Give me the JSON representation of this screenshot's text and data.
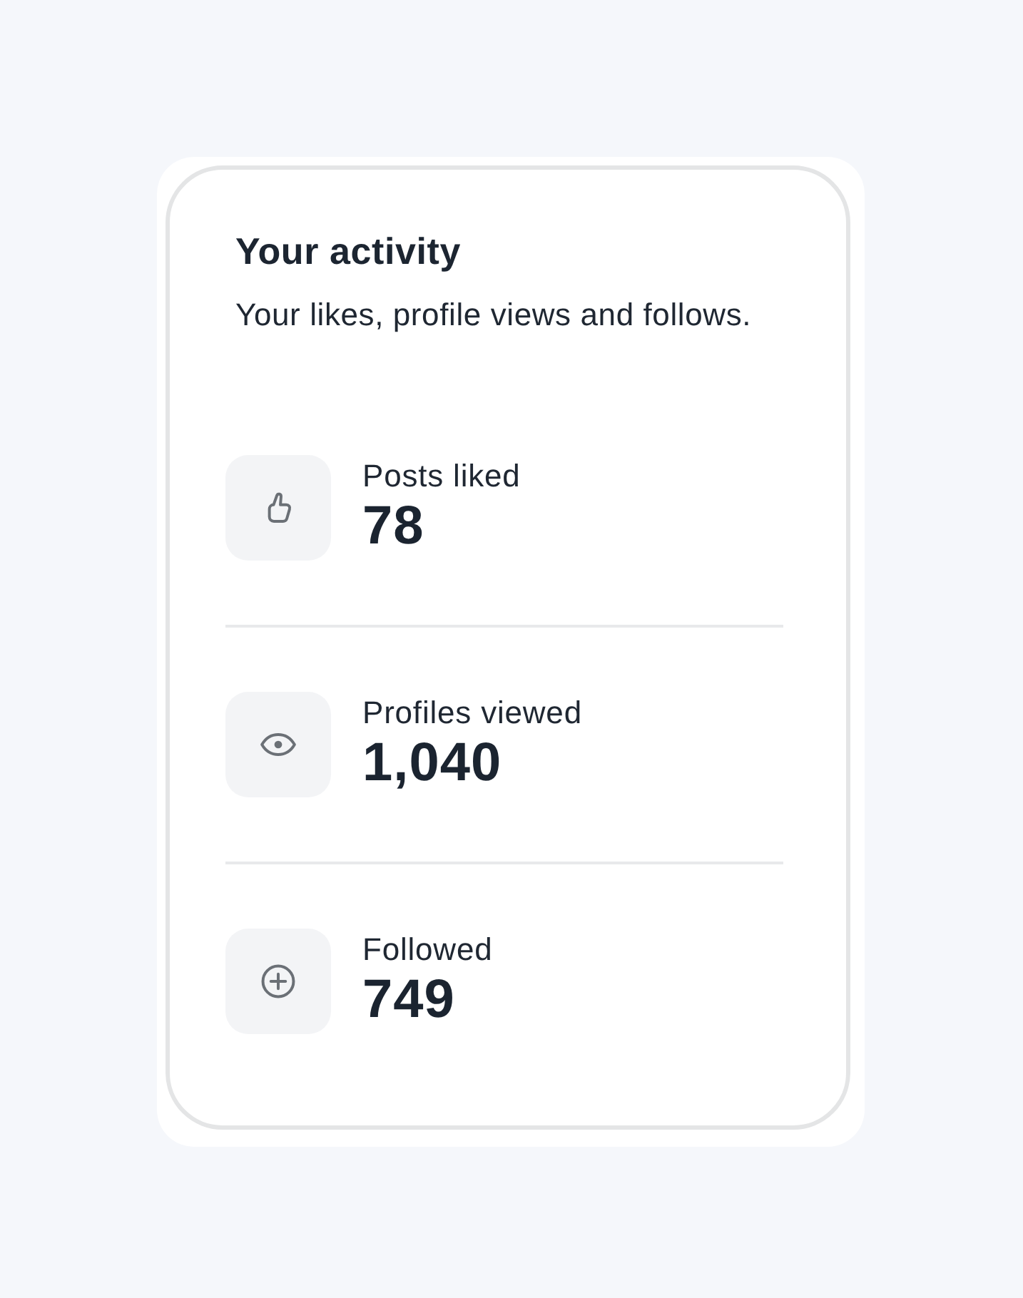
{
  "card": {
    "title": "Your activity",
    "subtitle": "Your likes, profile views and follows."
  },
  "stats": [
    {
      "kind": "like",
      "label": "Posts liked",
      "value": "78"
    },
    {
      "kind": "view",
      "label": "Profiles viewed",
      "value": "1,040"
    },
    {
      "kind": "follow",
      "label": "Followed",
      "value": "749"
    }
  ]
}
